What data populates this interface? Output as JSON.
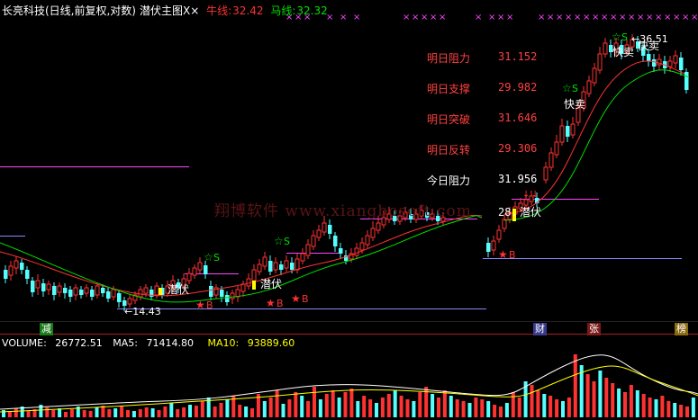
{
  "header": {
    "title": "长亮科技(日线,前复权,对数)",
    "indicator": "潜伏主图X",
    "niu_label": "牛线:",
    "niu_value": "32.42",
    "ma_label": "马线:",
    "ma_value": "32.32"
  },
  "info_panel": [
    {
      "label": "明日阻力",
      "value": "31.152",
      "color": "#ff4040"
    },
    {
      "label": "明日支撑",
      "value": "29.982",
      "color": "#ff4040"
    },
    {
      "label": "明日突破",
      "value": "31.646",
      "color": "#ff4040"
    },
    {
      "label": "明日反转",
      "value": "29.306",
      "color": "#ff4040"
    },
    {
      "label": "今日阻力",
      "value": "31.956",
      "color": "#ffffff"
    }
  ],
  "partial_value": "28.",
  "annotations": {
    "qianfu": "潜伏",
    "kuaimai": "快卖",
    "buy_mark": "B",
    "sell_mark": "S",
    "low_price": "←14.43",
    "high_price": "←36.51"
  },
  "badges": {
    "jian": "减",
    "cai": "财",
    "zhang": "张",
    "bang": "榜"
  },
  "volume": {
    "label": "VOLUME:",
    "value": "26772.51",
    "ma5_label": "MA5:",
    "ma5_value": "71414.80",
    "ma10_label": "MA10:",
    "ma10_value": "93889.60"
  },
  "watermark": "翔博软件 www.xiangbosoft.com",
  "colors": {
    "background": "#000000",
    "up": "#ff3232",
    "down": "#54ffff",
    "ma_red": "#ff3232",
    "ma_green": "#00e000",
    "magenta": "#ff44ff",
    "yellow": "#ffff00",
    "blue_line": "#8888ff"
  }
}
